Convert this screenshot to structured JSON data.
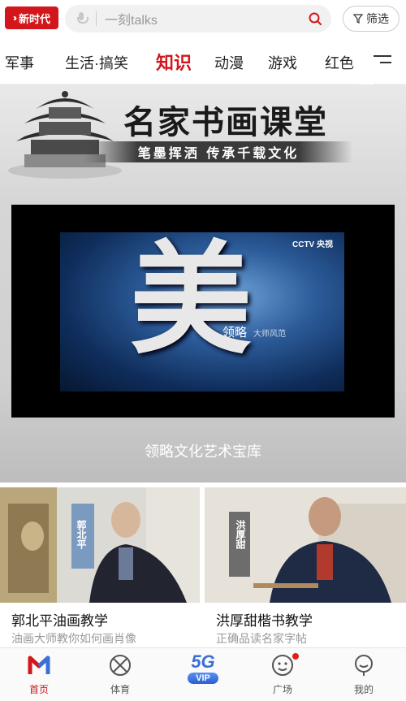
{
  "topbar": {
    "logo_text": "新时代",
    "search_placeholder": "一刻talks",
    "filter_label": "筛选"
  },
  "tabs": [
    "军事",
    "生活·搞笑",
    "知识",
    "动漫",
    "游戏",
    "红色"
  ],
  "active_tab": "知识",
  "banner": {
    "title": "名家书画课堂",
    "subtitle": "笔墨挥洒 传承千载文化",
    "video_brand": "CCTV 央视",
    "video_char": "美",
    "video_text": "领略",
    "video_subtext": "大师风范",
    "caption": "领略文化艺术宝库"
  },
  "cards": [
    {
      "title": "郭北平油画教学",
      "subtitle": "油画大师教你如何画肖像",
      "sign": "郭北平"
    },
    {
      "title": "洪厚甜楷书教学",
      "subtitle": "正确品读名家字帖",
      "sign": "洪厚甜"
    }
  ],
  "bottomnav": {
    "home": "首页",
    "sports": "体育",
    "vip_top": "5G",
    "vip": "VIP",
    "square": "广场",
    "mine": "我的"
  },
  "colors": {
    "accent": "#d3161b",
    "vip": "#3a6fd6"
  }
}
